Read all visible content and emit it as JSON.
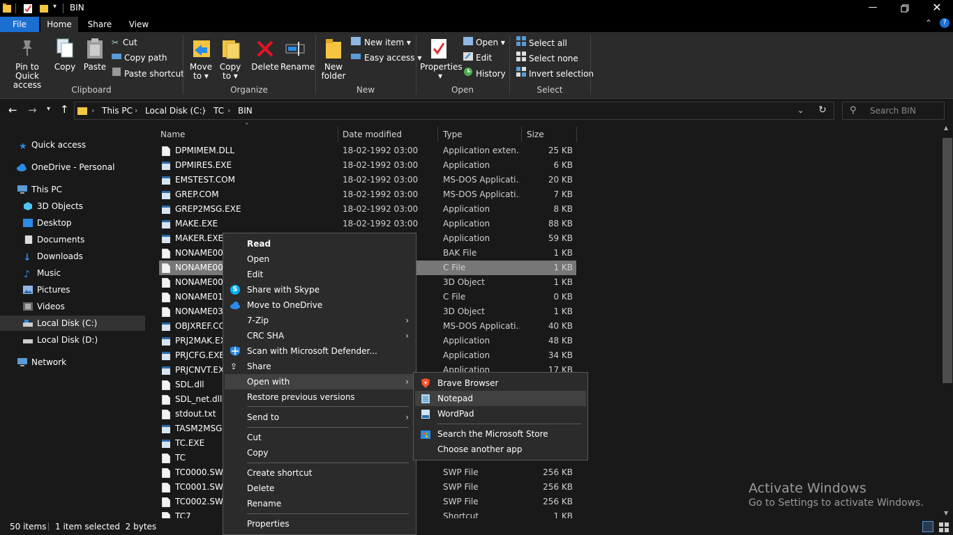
{
  "window": {
    "title": "BIN"
  },
  "tabs": [
    {
      "label": "File"
    },
    {
      "label": "Home"
    },
    {
      "label": "Share"
    },
    {
      "label": "View"
    }
  ],
  "ribbon": {
    "clipboard": {
      "group_label": "Clipboard",
      "pin_label_1": "Pin to Quick",
      "pin_label_2": "access",
      "copy_label": "Copy",
      "paste_label": "Paste",
      "cut_label": "Cut",
      "copy_path_label": "Copy path",
      "paste_shortcut_label": "Paste shortcut"
    },
    "organize": {
      "group_label": "Organize",
      "move_to_1": "Move",
      "move_to_2": "to ▾",
      "copy_to_1": "Copy",
      "copy_to_2": "to ▾",
      "delete_label": "Delete",
      "rename_label": "Rename"
    },
    "new": {
      "group_label": "New",
      "new_folder_1": "New",
      "new_folder_2": "folder",
      "new_item_label": "New item ▾",
      "easy_access_label": "Easy access ▾"
    },
    "open": {
      "group_label": "Open",
      "properties_label": "Properties",
      "open_label": "Open ▾",
      "edit_label": "Edit",
      "history_label": "History"
    },
    "select": {
      "group_label": "Select",
      "select_all_label": "Select all",
      "select_none_label": "Select none",
      "invert_selection_label": "Invert selection"
    }
  },
  "address": {
    "crumbs": [
      "This PC",
      "Local Disk (C:)",
      "TC",
      "BIN"
    ],
    "search_placeholder": "Search BIN"
  },
  "nav": {
    "items": [
      {
        "label": "Quick access"
      },
      {
        "label": "OneDrive - Personal"
      },
      {
        "label": "This PC"
      },
      {
        "label": "3D Objects"
      },
      {
        "label": "Desktop"
      },
      {
        "label": "Documents"
      },
      {
        "label": "Downloads"
      },
      {
        "label": "Music"
      },
      {
        "label": "Pictures"
      },
      {
        "label": "Videos"
      },
      {
        "label": "Local Disk (C:)"
      },
      {
        "label": "Local Disk (D:)"
      },
      {
        "label": "Network"
      }
    ]
  },
  "columns": {
    "name": "Name",
    "date": "Date modified",
    "type": "Type",
    "size": "Size"
  },
  "files": [
    {
      "name": "DPMIMEM.DLL",
      "date": "18-02-1992 03:00",
      "type": "Application exten...",
      "size": "25 KB"
    },
    {
      "name": "DPMIRES.EXE",
      "date": "18-02-1992 03:00",
      "type": "Application",
      "size": "6 KB"
    },
    {
      "name": "EMSTEST.COM",
      "date": "18-02-1992 03:00",
      "type": "MS-DOS Applicati...",
      "size": "20 KB"
    },
    {
      "name": "GREP.COM",
      "date": "18-02-1992 03:00",
      "type": "MS-DOS Applicati...",
      "size": "7 KB"
    },
    {
      "name": "GREP2MSG.EXE",
      "date": "18-02-1992 03:00",
      "type": "Application",
      "size": "8 KB"
    },
    {
      "name": "MAKE.EXE",
      "date": "18-02-1992 03:00",
      "type": "Application",
      "size": "88 KB"
    },
    {
      "name": "MAKER.EXE",
      "date": "",
      "type": "Application",
      "size": "59 KB"
    },
    {
      "name": "NONAME00.",
      "date": "",
      "type": "BAK File",
      "size": "1 KB"
    },
    {
      "name": "NONAME00.",
      "date": "",
      "type": "C File",
      "size": "1 KB"
    },
    {
      "name": "NONAME00.",
      "date": "",
      "type": "3D Object",
      "size": "1 KB"
    },
    {
      "name": "NONAME01.",
      "date": "",
      "type": "C File",
      "size": "0 KB"
    },
    {
      "name": "NONAME03.",
      "date": "",
      "type": "3D Object",
      "size": "1 KB"
    },
    {
      "name": "OBJXREF.COM",
      "date": "",
      "type": "MS-DOS Applicati...",
      "size": "40 KB"
    },
    {
      "name": "PRJ2MAK.EXE",
      "date": "",
      "type": "Application",
      "size": "48 KB"
    },
    {
      "name": "PRJCFG.EXE",
      "date": "",
      "type": "Application",
      "size": "34 KB"
    },
    {
      "name": "PRJCNVT.EXE",
      "date": "",
      "type": "Application",
      "size": "17 KB"
    },
    {
      "name": "SDL.dll",
      "date": "",
      "type": "",
      "size": ""
    },
    {
      "name": "SDL_net.dll",
      "date": "",
      "type": "",
      "size": ""
    },
    {
      "name": "stdout.txt",
      "date": "",
      "type": "",
      "size": ""
    },
    {
      "name": "TASM2MSG.EXE",
      "date": "",
      "type": "",
      "size": ""
    },
    {
      "name": "TC.EXE",
      "date": "",
      "type": "",
      "size": ""
    },
    {
      "name": "TC",
      "date": "",
      "type": "",
      "size": ""
    },
    {
      "name": "TC0000.SWP",
      "date": "",
      "type": "SWP File",
      "size": "256 KB"
    },
    {
      "name": "TC0001.SWP",
      "date": "",
      "type": "SWP File",
      "size": "256 KB"
    },
    {
      "name": "TC0002.SWP",
      "date": "",
      "type": "SWP File",
      "size": "256 KB"
    },
    {
      "name": "TC7",
      "date": "",
      "type": "Shortcut",
      "size": "1 KB"
    }
  ],
  "context_menu": {
    "read": "Read",
    "open": "Open",
    "edit": "Edit",
    "share_skype": "Share with Skype",
    "move_onedrive": "Move to OneDrive",
    "seven_zip": "7-Zip",
    "crc_sha": "CRC SHA",
    "scan_defender": "Scan with Microsoft Defender...",
    "share": "Share",
    "open_with": "Open with",
    "restore": "Restore previous versions",
    "send_to": "Send to",
    "cut": "Cut",
    "copy": "Copy",
    "create_shortcut": "Create shortcut",
    "delete": "Delete",
    "rename": "Rename",
    "properties": "Properties"
  },
  "open_with_menu": {
    "brave": "Brave Browser",
    "notepad": "Notepad",
    "wordpad": "WordPad",
    "store": "Search the Microsoft Store",
    "choose": "Choose another app"
  },
  "status": {
    "count": "50 items",
    "selection": "1 item selected  2 bytes"
  },
  "watermark": {
    "line1": "Activate Windows",
    "line2": "Go to Settings to activate Windows."
  },
  "colors": {
    "file_tab": "#1a6fd1",
    "accent_blue": "#1e90ff",
    "delete_red": "#e81123",
    "folder_yellow": "#f5c542"
  }
}
